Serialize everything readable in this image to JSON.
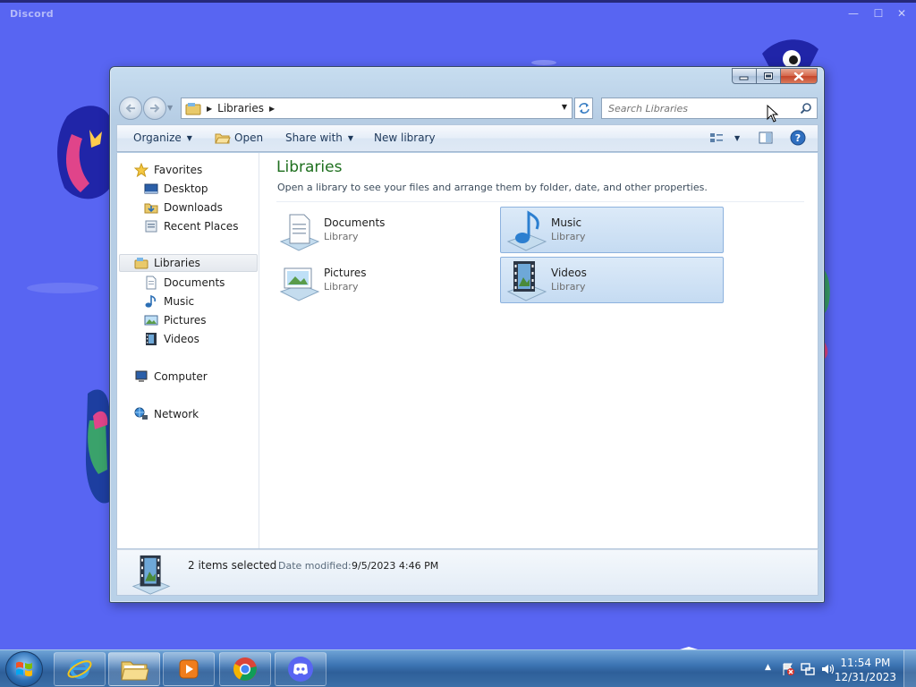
{
  "discord": {
    "title": "Discord"
  },
  "window": {
    "caption": {
      "minimize": "–",
      "restore": "▭",
      "close": "✕"
    },
    "address": {
      "crumbs": [
        "Libraries"
      ]
    },
    "search": {
      "placeholder": "Search Libraries"
    },
    "toolbar": {
      "organize": "Organize",
      "open": "Open",
      "share_with": "Share with",
      "new_library": "New library"
    },
    "nav_pane": {
      "favorites": {
        "label": "Favorites",
        "items": [
          "Desktop",
          "Downloads",
          "Recent Places"
        ]
      },
      "libraries": {
        "label": "Libraries",
        "items": [
          "Documents",
          "Music",
          "Pictures",
          "Videos"
        ]
      },
      "computer": "Computer",
      "network": "Network"
    },
    "main": {
      "title": "Libraries",
      "description": "Open a library to see your files and arrange them by folder, date, and other properties.",
      "libraries": [
        {
          "name": "Documents",
          "type": "Library",
          "selected": false
        },
        {
          "name": "Music",
          "type": "Library",
          "selected": true
        },
        {
          "name": "Pictures",
          "type": "Library",
          "selected": false
        },
        {
          "name": "Videos",
          "type": "Library",
          "selected": true
        }
      ]
    },
    "details": {
      "count": "2 items selected",
      "modified_label": "Date modified:",
      "modified_value": "9/5/2023 4:46 PM"
    }
  },
  "taskbar": {
    "clock": {
      "time": "11:54 PM",
      "date": "12/31/2023"
    },
    "tray_arrow": "▲"
  },
  "colors": {
    "discord_bg": "#5865F2",
    "title_green": "#1e6f1e",
    "selection": "#c5dbf2"
  }
}
